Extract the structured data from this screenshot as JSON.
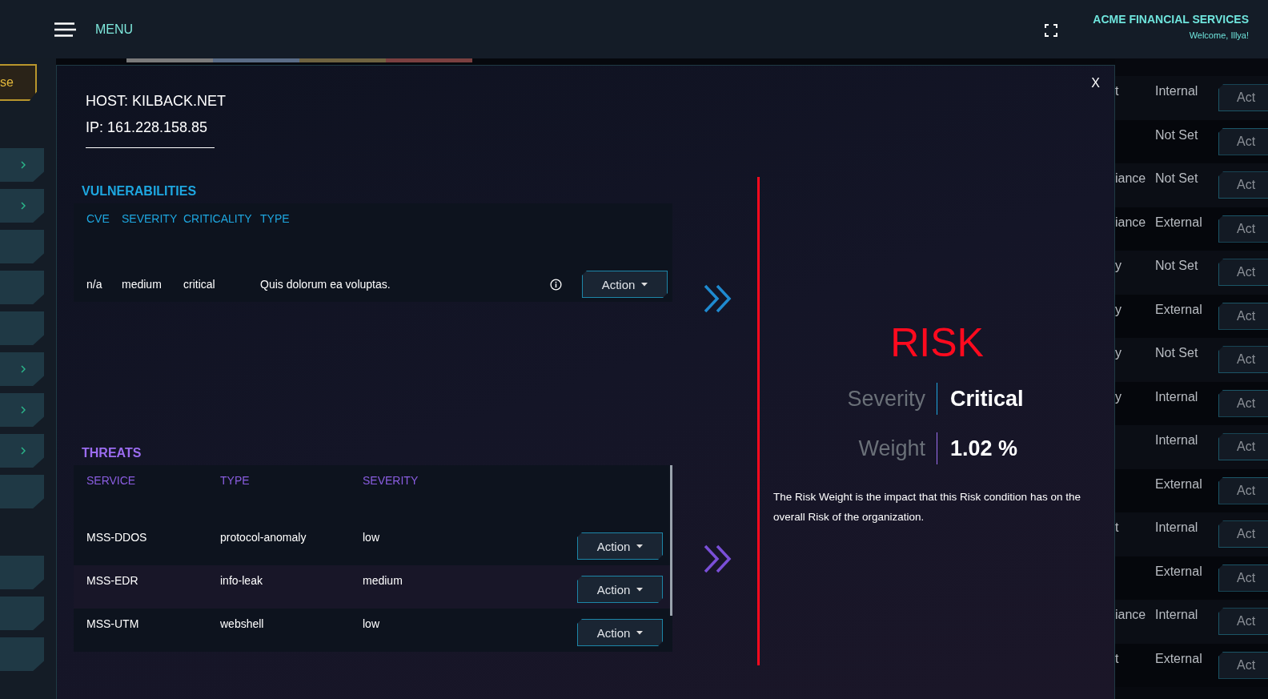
{
  "header": {
    "menu_label": "MENU",
    "company": "ACME FINANCIAL SERVICES",
    "welcome": "Welcome, Illya!"
  },
  "sidebar": {
    "button_label": "se",
    "tab_groups": [
      [
        {
          "expandable": true
        },
        {
          "expandable": true
        },
        {
          "expandable": false
        },
        {
          "expandable": false
        },
        {
          "expandable": false
        },
        {
          "expandable": true
        },
        {
          "expandable": true
        },
        {
          "expandable": true
        },
        {
          "expandable": false
        }
      ],
      [
        {
          "expandable": false
        },
        {
          "expandable": false
        },
        {
          "expandable": false
        }
      ]
    ]
  },
  "modal": {
    "close_label": "X",
    "host": "HOST: KILBACK.NET",
    "ip": "IP: 161.228.158.85",
    "vulnerabilities": {
      "title": "VULNERABILITIES",
      "columns": [
        "CVE",
        "SEVERITY",
        "CRITICALITY",
        "TYPE"
      ],
      "rows": [
        {
          "cells": [
            "n/a",
            "medium",
            "critical",
            "Quis dolorum ea voluptas."
          ],
          "action": "Action"
        }
      ]
    },
    "threats": {
      "title": "THREATS",
      "columns": [
        "SERVICE",
        "TYPE",
        "SEVERITY"
      ],
      "rows": [
        {
          "cells": [
            "MSS-DDOS",
            "protocol-anomaly",
            "low"
          ],
          "action": "Action"
        },
        {
          "cells": [
            "MSS-EDR",
            "info-leak",
            "medium"
          ],
          "action": "Action"
        },
        {
          "cells": [
            "MSS-UTM",
            "webshell",
            "low"
          ],
          "action": "Action"
        }
      ]
    },
    "risk": {
      "title": "RISK",
      "severity_label": "Severity",
      "severity": "Critical",
      "weight_label": "Weight",
      "weight": "1.02 %",
      "description": "The Risk Weight is the impact that this Risk condition has on the overall Risk of the organization."
    }
  },
  "background_rows": [
    {
      "column_1": "t",
      "column_2": "Internal",
      "action": "Act"
    },
    {
      "column_2": "Not Set",
      "action": "Act"
    },
    {
      "column_1": "iance",
      "column_2": "Not Set",
      "action": "Act"
    },
    {
      "column_1": "iance",
      "column_2": "External",
      "action": "Act"
    },
    {
      "column_1": "y",
      "column_2": "Not Set",
      "action": "Act"
    },
    {
      "column_1": "y",
      "column_2": "External",
      "action": "Act"
    },
    {
      "column_1": "y",
      "column_2": "Not Set",
      "action": "Act"
    },
    {
      "column_1": "y",
      "column_2": "Internal",
      "action": "Act"
    },
    {
      "column_2": "Internal",
      "action": "Act"
    },
    {
      "column_2": "External",
      "action": "Act"
    },
    {
      "column_1": "t",
      "column_2": "Internal",
      "action": "Act"
    },
    {
      "column_2": "External",
      "action": "Act"
    },
    {
      "column_1": "iance",
      "column_2": "Internal",
      "action": "Act"
    },
    {
      "column_1": "t",
      "column_2": "External",
      "action": "Act"
    }
  ]
}
